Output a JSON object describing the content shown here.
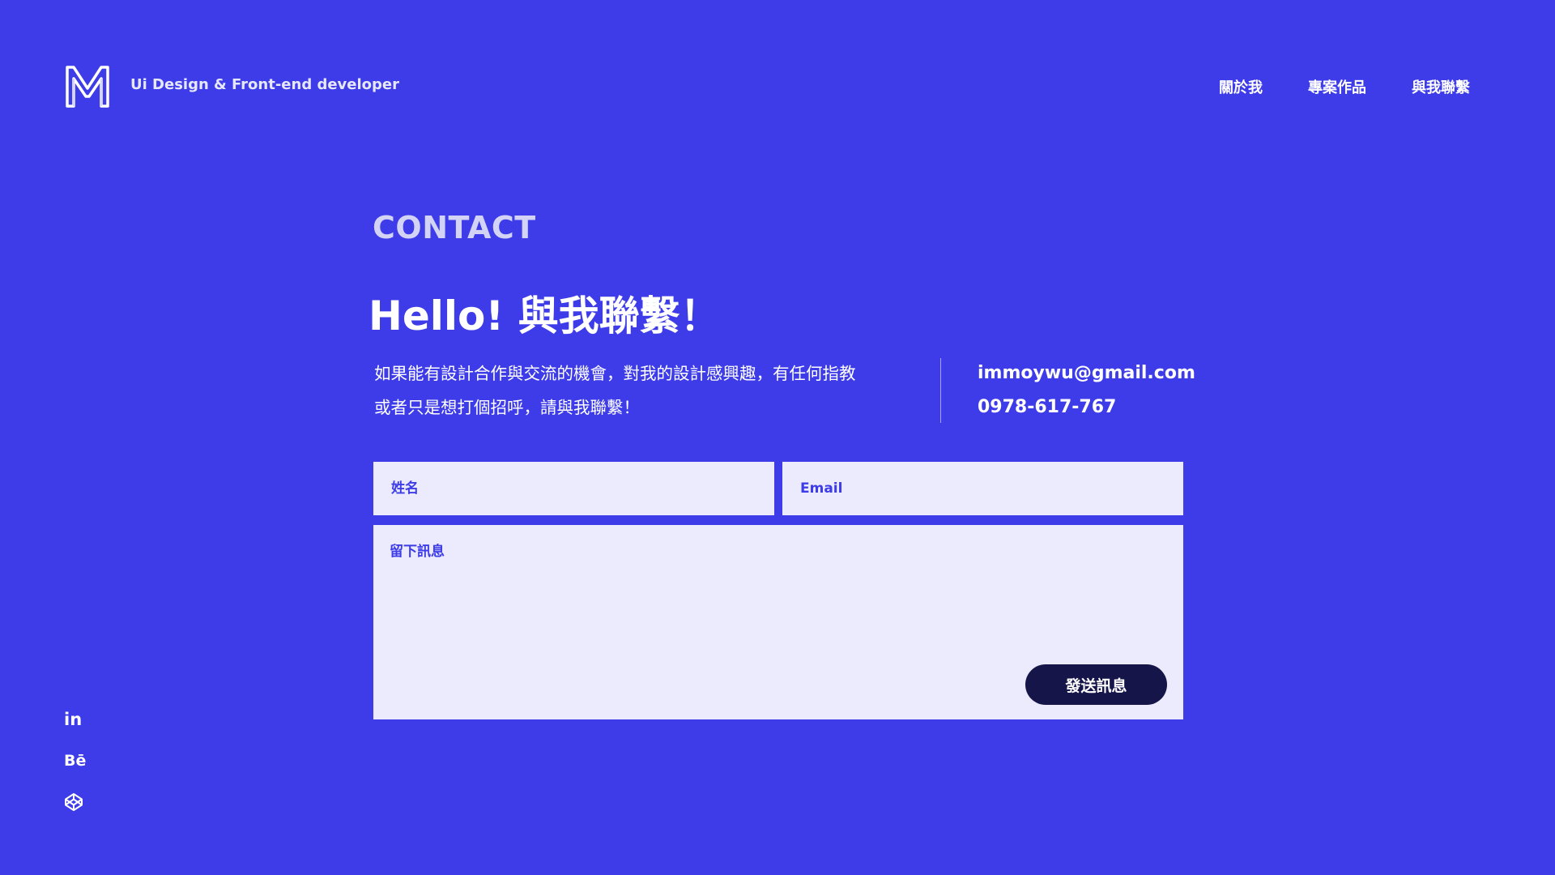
{
  "header": {
    "tagline": "Ui Design & Front-end developer",
    "nav": [
      {
        "label": "關於我"
      },
      {
        "label": "專案作品"
      },
      {
        "label": "與我聯繫"
      }
    ]
  },
  "contact": {
    "section_label": "CONTACT",
    "title": "Hello! 與我聯繫！",
    "intro_line1": "如果能有設計合作與交流的機會，對我的設計感興趣，有任何指教",
    "intro_line2": "或者只是想打個招呼，請與我聯繫！",
    "email": "immoywu@gmail.com",
    "phone": "0978-617-767"
  },
  "form": {
    "name_placeholder": "姓名",
    "email_placeholder": "Email",
    "message_placeholder": "留下訊息",
    "submit_label": "發送訊息"
  },
  "social": {
    "linkedin_text": "in",
    "behance_text": "Bē",
    "icons": [
      "linkedin-icon",
      "behance-icon",
      "codepen-icon"
    ]
  },
  "colors": {
    "background": "#3d3ce8",
    "field_background": "#ebebfd",
    "button_background": "#16154a",
    "text": "#ffffff"
  }
}
